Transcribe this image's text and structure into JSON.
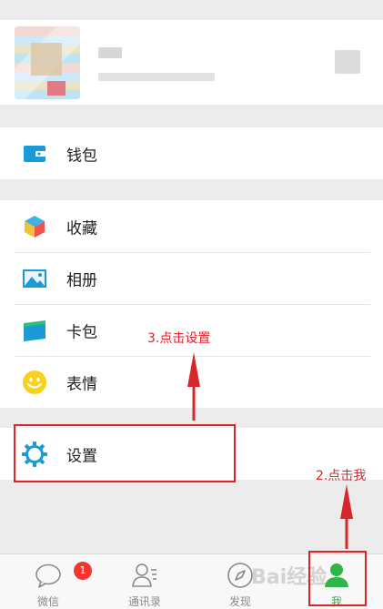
{
  "menu": {
    "wallet": "钱包",
    "favorites": "收藏",
    "album": "相册",
    "cards": "卡包",
    "stickers": "表情",
    "settings": "设置"
  },
  "tabs": {
    "chats": "微信",
    "chats_badge": "1",
    "contacts": "通讯录",
    "discover": "发现",
    "me": "我"
  },
  "annotations": {
    "click_settings": "3.点击设置",
    "click_me": "2.点击我"
  },
  "watermark": "Bai经验",
  "colors": {
    "accent_green": "#2eb64a",
    "badge_red": "#f43530",
    "annotation_red": "#d9262b",
    "icon_blue": "#1a9ad6"
  }
}
